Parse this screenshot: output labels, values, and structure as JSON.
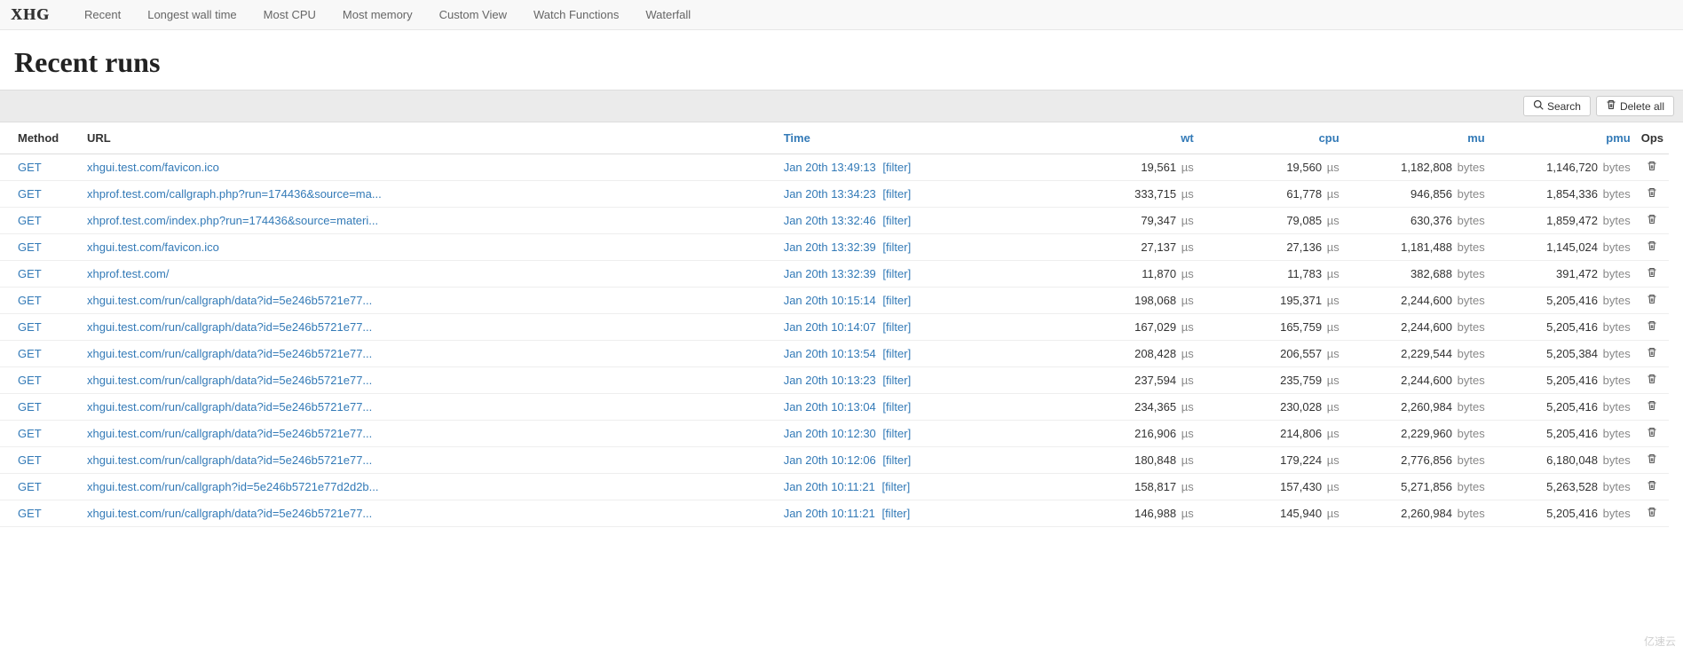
{
  "brand": "XHG",
  "nav": [
    "Recent",
    "Longest wall time",
    "Most CPU",
    "Most memory",
    "Custom View",
    "Watch Functions",
    "Waterfall"
  ],
  "title": "Recent runs",
  "buttons": {
    "search": "Search",
    "delete_all": "Delete all"
  },
  "headers": {
    "method": "Method",
    "url": "URL",
    "time": "Time",
    "wt": "wt",
    "cpu": "cpu",
    "mu": "mu",
    "pmu": "pmu",
    "ops": "Ops"
  },
  "units": {
    "us": "µs",
    "bytes": "bytes"
  },
  "filter_label": "[filter]",
  "rows": [
    {
      "method": "GET",
      "url": "xhgui.test.com/favicon.ico",
      "time": "Jan 20th 13:49:13",
      "wt": "19,561",
      "cpu": "19,560",
      "mu": "1,182,808",
      "pmu": "1,146,720"
    },
    {
      "method": "GET",
      "url": "xhprof.test.com/callgraph.php?run=174436&source=ma...",
      "time": "Jan 20th 13:34:23",
      "wt": "333,715",
      "cpu": "61,778",
      "mu": "946,856",
      "pmu": "1,854,336"
    },
    {
      "method": "GET",
      "url": "xhprof.test.com/index.php?run=174436&source=materi...",
      "time": "Jan 20th 13:32:46",
      "wt": "79,347",
      "cpu": "79,085",
      "mu": "630,376",
      "pmu": "1,859,472"
    },
    {
      "method": "GET",
      "url": "xhgui.test.com/favicon.ico",
      "time": "Jan 20th 13:32:39",
      "wt": "27,137",
      "cpu": "27,136",
      "mu": "1,181,488",
      "pmu": "1,145,024"
    },
    {
      "method": "GET",
      "url": "xhprof.test.com/",
      "time": "Jan 20th 13:32:39",
      "wt": "11,870",
      "cpu": "11,783",
      "mu": "382,688",
      "pmu": "391,472"
    },
    {
      "method": "GET",
      "url": "xhgui.test.com/run/callgraph/data?id=5e246b5721e77...",
      "time": "Jan 20th 10:15:14",
      "wt": "198,068",
      "cpu": "195,371",
      "mu": "2,244,600",
      "pmu": "5,205,416"
    },
    {
      "method": "GET",
      "url": "xhgui.test.com/run/callgraph/data?id=5e246b5721e77...",
      "time": "Jan 20th 10:14:07",
      "wt": "167,029",
      "cpu": "165,759",
      "mu": "2,244,600",
      "pmu": "5,205,416"
    },
    {
      "method": "GET",
      "url": "xhgui.test.com/run/callgraph/data?id=5e246b5721e77...",
      "time": "Jan 20th 10:13:54",
      "wt": "208,428",
      "cpu": "206,557",
      "mu": "2,229,544",
      "pmu": "5,205,384"
    },
    {
      "method": "GET",
      "url": "xhgui.test.com/run/callgraph/data?id=5e246b5721e77...",
      "time": "Jan 20th 10:13:23",
      "wt": "237,594",
      "cpu": "235,759",
      "mu": "2,244,600",
      "pmu": "5,205,416"
    },
    {
      "method": "GET",
      "url": "xhgui.test.com/run/callgraph/data?id=5e246b5721e77...",
      "time": "Jan 20th 10:13:04",
      "wt": "234,365",
      "cpu": "230,028",
      "mu": "2,260,984",
      "pmu": "5,205,416"
    },
    {
      "method": "GET",
      "url": "xhgui.test.com/run/callgraph/data?id=5e246b5721e77...",
      "time": "Jan 20th 10:12:30",
      "wt": "216,906",
      "cpu": "214,806",
      "mu": "2,229,960",
      "pmu": "5,205,416"
    },
    {
      "method": "GET",
      "url": "xhgui.test.com/run/callgraph/data?id=5e246b5721e77...",
      "time": "Jan 20th 10:12:06",
      "wt": "180,848",
      "cpu": "179,224",
      "mu": "2,776,856",
      "pmu": "6,180,048"
    },
    {
      "method": "GET",
      "url": "xhgui.test.com/run/callgraph?id=5e246b5721e77d2d2b...",
      "time": "Jan 20th 10:11:21",
      "wt": "158,817",
      "cpu": "157,430",
      "mu": "5,271,856",
      "pmu": "5,263,528"
    },
    {
      "method": "GET",
      "url": "xhgui.test.com/run/callgraph/data?id=5e246b5721e77...",
      "time": "Jan 20th 10:11:21",
      "wt": "146,988",
      "cpu": "145,940",
      "mu": "2,260,984",
      "pmu": "5,205,416"
    }
  ],
  "watermark": "亿速云"
}
